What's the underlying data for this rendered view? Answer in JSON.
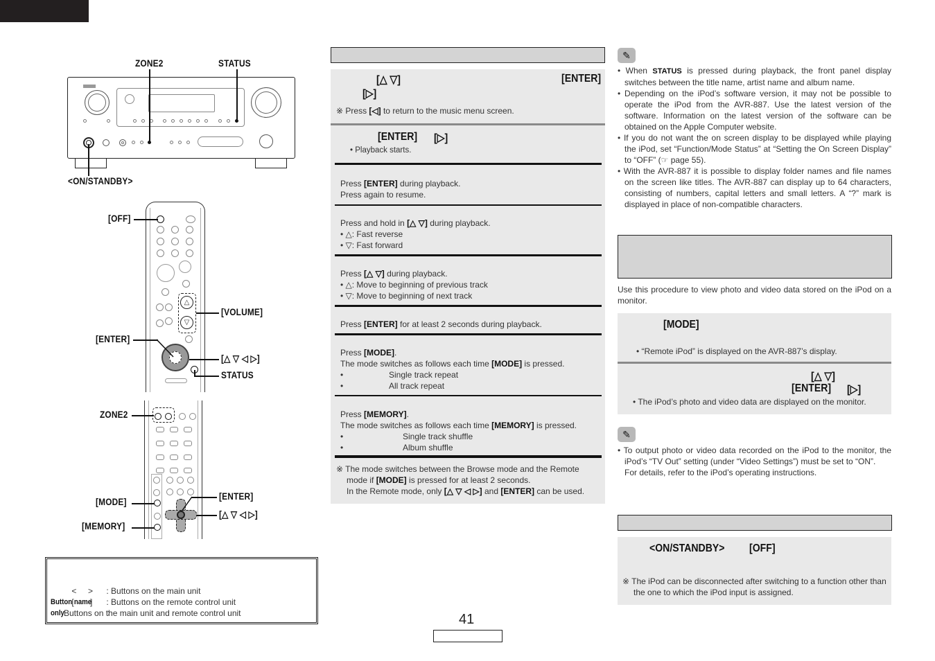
{
  "page": {
    "number": "41",
    "footer_box": ""
  },
  "figures": {
    "main_unit": {
      "labels": {
        "zone2": "ZONE2",
        "status": "STATUS",
        "on_standby": "<ON/STANDBY>"
      }
    },
    "remote_top": {
      "labels": {
        "off": "[OFF]",
        "volume": "[VOLUME]",
        "enter": "[ENTER]",
        "arrows": "[△ ▽ ◁ ▷]",
        "status": "STATUS"
      }
    },
    "remote_bottom": {
      "labels": {
        "zone2": "ZONE2",
        "mode": "[MODE]",
        "memory": "[MEMORY]",
        "enter": "[ENTER]",
        "arrows": "[△ ▽ ◁ ▷]"
      }
    }
  },
  "legend": {
    "rows": [
      {
        "symbol": "<     >",
        "desc": ": Buttons on the main unit"
      },
      {
        "symbol": "[       ]",
        "desc": ": Buttons on the remote control unit"
      }
    ],
    "button_name_only_label": "Button name only",
    "button_name_only_colon": " :",
    "button_name_only_desc": "Buttons on the main unit and remote control unit"
  },
  "middle": {
    "step1": {
      "key_arrows": "[△ ▽]",
      "key_enter": "[ENTER]",
      "key_right": "[▷]",
      "note_prefix": "※ Press ",
      "note_key": "[◁]",
      "note_suffix": " to return to the music menu screen."
    },
    "step2": {
      "key_enter": "[ENTER]",
      "key_right": "[▷]",
      "bullet": "• Playback starts."
    },
    "ops": [
      {
        "lines": [
          {
            "pre": "Press ",
            "key": "[ENTER]",
            "post": " during playback."
          },
          {
            "pre": "Press again to resume.",
            "key": "",
            "post": ""
          }
        ]
      },
      {
        "lines": [
          {
            "pre": "Press and hold in ",
            "key": "[△ ▽]",
            "post": " during playback."
          },
          {
            "pre": "• △: Fast reverse",
            "key": "",
            "post": ""
          },
          {
            "pre": "• ▽: Fast forward",
            "key": "",
            "post": ""
          }
        ]
      },
      {
        "lines": [
          {
            "pre": "Press ",
            "key": "[△ ▽]",
            "post": " during playback."
          },
          {
            "pre": "• △: Move to beginning of previous track",
            "key": "",
            "post": ""
          },
          {
            "pre": "• ▽: Move to beginning of next track",
            "key": "",
            "post": ""
          }
        ]
      },
      {
        "lines": [
          {
            "pre": "Press ",
            "key": "[ENTER]",
            "post": " for at least 2 seconds during playback."
          }
        ]
      },
      {
        "lines": [
          {
            "pre": "Press ",
            "key": "[MODE]",
            "post": "."
          },
          {
            "pre": "The mode switches as follows each time ",
            "key": "[MODE]",
            "post": " is pressed."
          }
        ],
        "items": [
          "Single track repeat",
          "All track repeat"
        ]
      },
      {
        "lines": [
          {
            "pre": "Press ",
            "key": "[MEMORY]",
            "post": "."
          },
          {
            "pre": "The mode switches as follows each time ",
            "key": "[MEMORY]",
            "post": " is pressed."
          }
        ],
        "items": [
          "Single track shuffle",
          "Album shuffle"
        ]
      }
    ],
    "footnote": {
      "l1": "※ The mode switches between the Browse mode and the Remote",
      "l2_pre": "mode if ",
      "l2_key": "[MODE]",
      "l2_post": " is pressed for at least 2 seconds.",
      "l3_pre": "In the Remote mode, only ",
      "l3_key1": "[△ ▽ ◁ ▷]",
      "l3_mid": " and ",
      "l3_key2": "[ENTER]",
      "l3_post": " can be used."
    }
  },
  "right": {
    "notes1": {
      "b1_pre": "• When ",
      "b1_key": "STATUS",
      "b1_post": " is pressed during playback, the front panel display switches between the title name, artist name and album name.",
      "b2": "• Depending on the iPod’s software version, it may not be possible to operate the iPod from the AVR-887. Use the latest version of the software. Information on the latest version of the software can be obtained on the Apple Computer website.",
      "b3": "• If you do not want the on screen display to be displayed while playing the iPod, set “Function/Mode Status” at “Setting the On Screen Display” to “OFF” (☞ page 55).",
      "b4": "• With the AVR-887 it is possible to display folder names and file names on the screen like titles. The AVR-887 can display up to 64 characters, consisting of numbers, capital letters and small letters. A “?” mark is displayed in place of non-compatible characters."
    },
    "photo_intro": "Use this procedure to view photo and video data stored on the iPod on a monitor.",
    "photo_step1": {
      "key": "[MODE]",
      "bullet": "• “Remote iPod” is displayed on the AVR-887’s display."
    },
    "photo_step2": {
      "key_arrows": "[△  ▽]",
      "key_enter": "[ENTER]",
      "key_right": "[▷]",
      "bullet": "• The iPod’s photo and video data are displayed on the monitor."
    },
    "notes2": {
      "b1": "• To output photo or video data recorded on the iPod to the monitor, the iPod’s “TV Out” setting (under “Video Settings”) must be set to “ON”.",
      "b1_cont": "For details, refer to the iPod’s operating instructions."
    },
    "disconnect": {
      "key1": "<ON/STANDBY>",
      "key2": "[OFF]",
      "note": "※ The iPod can be disconnected after switching to a function other than the one to which the iPod input is assigned."
    }
  }
}
